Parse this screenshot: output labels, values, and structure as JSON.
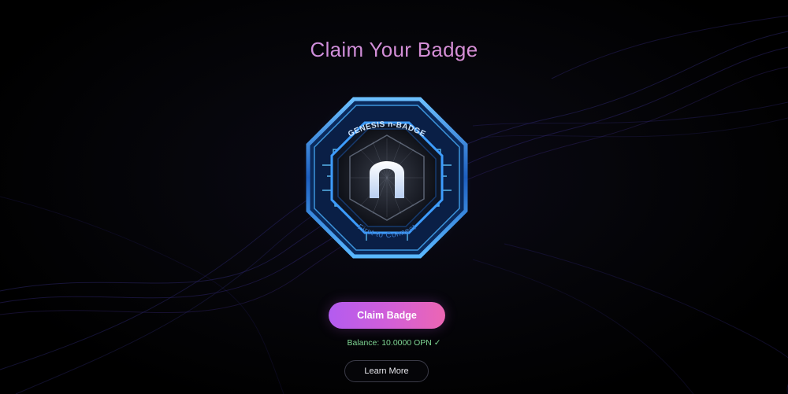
{
  "page": {
    "title": "Claim Your Badge"
  },
  "badge": {
    "top_text": "GENESIS n-BADGE",
    "center_glyph": "n",
    "bottom_text": "First to Connect"
  },
  "actions": {
    "claim_label": "Claim Badge",
    "learn_more_label": "Learn More"
  },
  "status": {
    "balance_text": "Balance: 10.0000 OPN ✓"
  },
  "colors": {
    "background": "#000000",
    "title": "#c587e0",
    "button_gradient_start": "#b35cf0",
    "button_gradient_end": "#ec66b3",
    "balance": "#7fd693",
    "badge_blue": "#3aa0ff"
  },
  "icons": [
    "check-icon",
    "n-logo-icon",
    "background-lines"
  ]
}
